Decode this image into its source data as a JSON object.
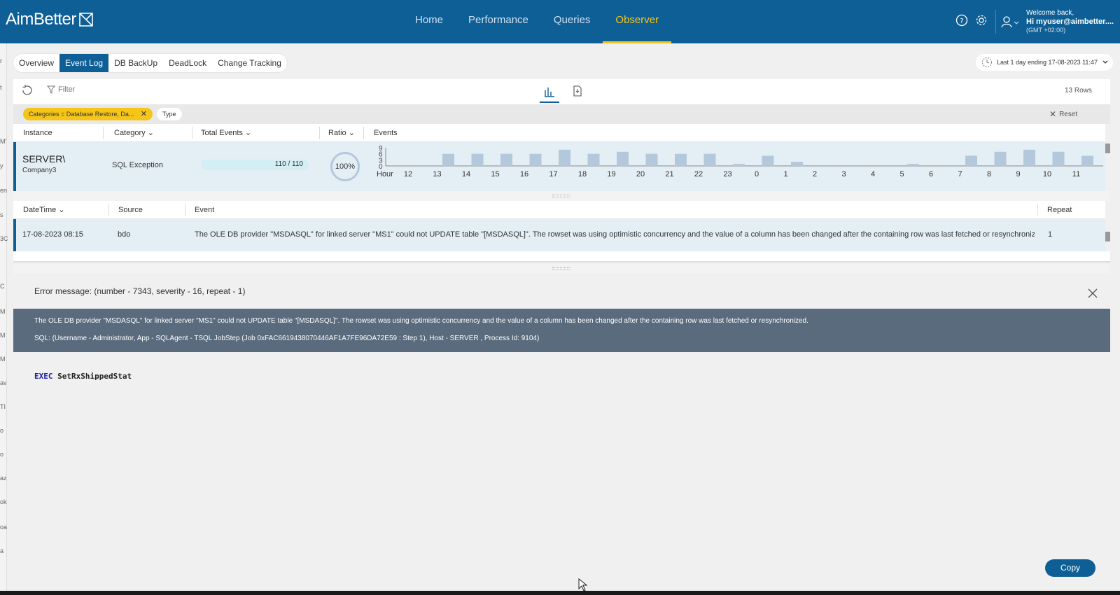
{
  "header": {
    "logo": "AimBetter",
    "nav": [
      "Home",
      "Performance",
      "Queries",
      "Observer"
    ],
    "active_nav": "Observer",
    "welcome": "Welcome back,",
    "user": "Hi myuser@aimbetter....",
    "timezone": "(GMT +02:00)"
  },
  "tabs": [
    "Overview",
    "Event Log",
    "DB BackUp",
    "DeadLock",
    "Change Tracking"
  ],
  "active_tab": "Event Log",
  "time_range": "Last 1 day ending  17-08-2023 11:47",
  "toolbar": {
    "filter_label": "Filter",
    "rows": "13 Rows"
  },
  "filters": {
    "chip_category": "Categories = Database Restore, Da...",
    "chip_type": "Type",
    "reset": "Reset"
  },
  "instance_table": {
    "headers": {
      "instance": "Instance",
      "category": "Category",
      "total_events": "Total Events",
      "ratio": "Ratio",
      "events": "Events"
    },
    "row": {
      "server": "SERVER\\",
      "company": "Company3",
      "category": "SQL Exception",
      "total": "110 / 110",
      "progress": 1.0,
      "ratio": "100%"
    }
  },
  "chart_data": {
    "type": "bar",
    "xlabel": "Hour",
    "categories": [
      "12",
      "13",
      "14",
      "15",
      "16",
      "17",
      "18",
      "19",
      "20",
      "21",
      "22",
      "23",
      "0",
      "1",
      "2",
      "3",
      "4",
      "5",
      "6",
      "7",
      "8",
      "9",
      "10",
      "11"
    ],
    "values": [
      0,
      6,
      6,
      6,
      6,
      8,
      6,
      7,
      6,
      6,
      6,
      1,
      5,
      2,
      0,
      0,
      0,
      1,
      0,
      5,
      7,
      8,
      7,
      5
    ],
    "y_ticks": [
      "9",
      "6",
      "3",
      "0"
    ],
    "ylim": [
      0,
      9
    ]
  },
  "event_table": {
    "headers": {
      "datetime": "DateTime",
      "source": "Source",
      "event": "Event",
      "repeat": "Repeat"
    },
    "row": {
      "datetime": "17-08-2023 08:15",
      "source": "bdo",
      "event": "The OLE DB provider \"MSDASQL\" for linked server \"MS1\" could not UPDATE table \"[MSDASQL]\". The rowset was using optimistic concurrency and the value of a column has been changed after the containing row was last fetched or resynchroniz...",
      "repeat": "1"
    }
  },
  "error": {
    "title": "Error message: (number - 7343, severity - 16, repeat - 1)",
    "message": "The OLE DB provider \"MSDASQL\" for linked server \"MS1\" could not UPDATE table \"[MSDASQL]\". The rowset was using optimistic concurrency and the value of a column has been changed after the containing row was last fetched or resynchronized.",
    "sql_info": "SQL: (Username - Administrator, App - SQLAgent - TSQL JobStep (Job 0xFAC6619438070446AF1A7FE96DA72E59 : Step 1), Host - SERVER , Process Id: 9104)",
    "code_keyword": "EXEC",
    "code_rest": " SetRxShippedStat",
    "copy": "Copy"
  },
  "left_rail": [
    "r",
    "t",
    "M'",
    "y",
    "en",
    "s",
    "3C",
    "C",
    "M",
    "M",
    "M",
    "av",
    "TI",
    "o",
    "o",
    "az",
    "ok",
    "oa",
    "a"
  ],
  "colors": {
    "header": "#0f5f97",
    "accent": "#f5c518",
    "band": "#5a6b7d",
    "bar": "#b4c8dc"
  }
}
